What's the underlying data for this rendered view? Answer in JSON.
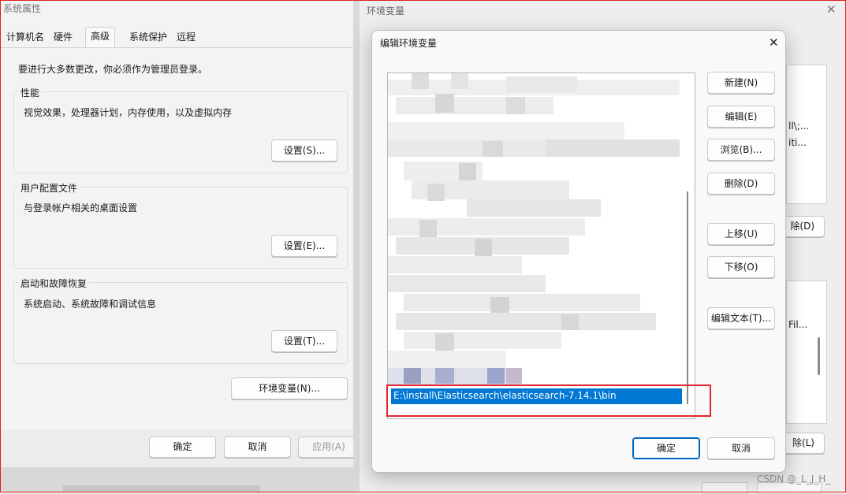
{
  "sys_props": {
    "title": "系统属性",
    "tabs": [
      "计算机名",
      "硬件",
      "高级",
      "系统保护",
      "远程"
    ],
    "admin_notice": "要进行大多数更改，你必须作为管理员登录。",
    "perf": {
      "label": "性能",
      "desc": "视觉效果，处理器计划，内存使用，以及虚拟内存",
      "button": "设置(S)..."
    },
    "profiles": {
      "label": "用户配置文件",
      "desc": "与登录帐户相关的桌面设置",
      "button": "设置(E)..."
    },
    "startup": {
      "label": "启动和故障恢复",
      "desc": "系统启动、系统故障和调试信息",
      "button": "设置(T)..."
    },
    "env_button": "环境变量(N)...",
    "ok": "确定",
    "cancel": "取消",
    "apply": "应用(A)"
  },
  "env_vars": {
    "title": "环境变量",
    "peek_top": "ll\\;...",
    "peek_top2": "iti...",
    "peek_delete": "除(D)",
    "peek_fil": "Fil...",
    "peek_delete2": "除(L)"
  },
  "edit_dialog": {
    "title": "编辑环境变量",
    "close": "✕",
    "selected_path": "E:\\install\\Elasticsearch\\elasticsearch-7.14.1\\bin",
    "buttons": {
      "new": "新建(N)",
      "edit": "编辑(E)",
      "browse": "浏览(B)...",
      "delete": "删除(D)",
      "up": "上移(U)",
      "down": "下移(O)",
      "edit_text": "编辑文本(T)..."
    },
    "ok": "确定",
    "cancel": "取消"
  },
  "watermark": "CSDN @_L_J_H_",
  "colors": {
    "selection": "#0078d4",
    "highlight_box": "#e0262e",
    "screen_border": "#e02020"
  }
}
